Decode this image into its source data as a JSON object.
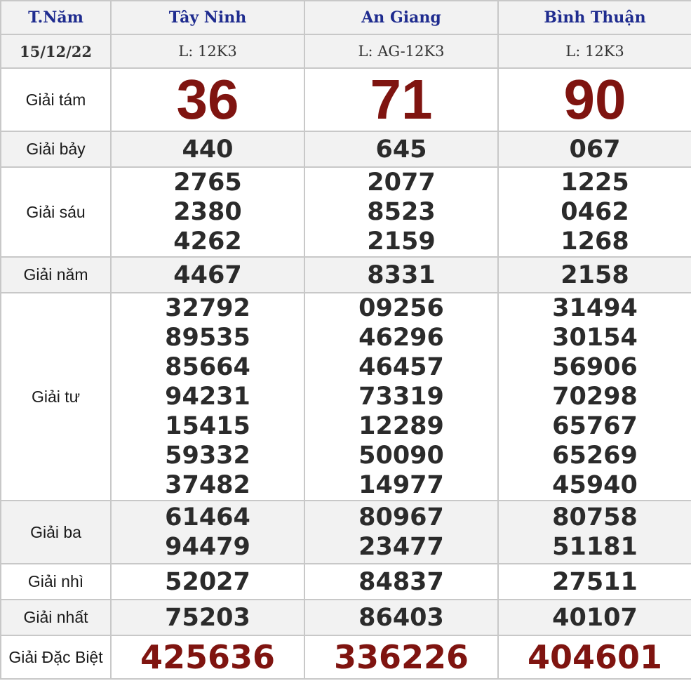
{
  "header": {
    "day_label": "T.Năm",
    "provinces": [
      "Tây Ninh",
      "An Giang",
      "Bình Thuận"
    ]
  },
  "subheader": {
    "date": "15/12/22",
    "tickets": [
      "L: 12K3",
      "L: AG-12K3",
      "L: 12K3"
    ]
  },
  "prizes": {
    "g8": {
      "label": "Giải tám",
      "values": [
        "36",
        "71",
        "90"
      ]
    },
    "g7": {
      "label": "Giải bảy",
      "values": [
        "440",
        "645",
        "067"
      ]
    },
    "g6": {
      "label": "Giải sáu",
      "values": [
        [
          "2765",
          "2380",
          "4262"
        ],
        [
          "2077",
          "8523",
          "2159"
        ],
        [
          "1225",
          "0462",
          "1268"
        ]
      ]
    },
    "g5": {
      "label": "Giải năm",
      "values": [
        "4467",
        "8331",
        "2158"
      ]
    },
    "g4": {
      "label": "Giải tư",
      "values": [
        [
          "32792",
          "89535",
          "85664",
          "94231",
          "15415",
          "59332",
          "37482"
        ],
        [
          "09256",
          "46296",
          "46457",
          "73319",
          "12289",
          "50090",
          "14977"
        ],
        [
          "31494",
          "30154",
          "56906",
          "70298",
          "65767",
          "65269",
          "45940"
        ]
      ]
    },
    "g3": {
      "label": "Giải ba",
      "values": [
        [
          "61464",
          "94479"
        ],
        [
          "80967",
          "23477"
        ],
        [
          "80758",
          "51181"
        ]
      ]
    },
    "g2": {
      "label": "Giải nhì",
      "values": [
        "52027",
        "84837",
        "27511"
      ]
    },
    "g1": {
      "label": "Giải nhất",
      "values": [
        "75203",
        "86403",
        "40107"
      ]
    },
    "gdb": {
      "label": "Giải Đặc Biệt",
      "values": [
        "425636",
        "336226",
        "404601"
      ]
    }
  },
  "colors": {
    "header_text": "#1f2c8f",
    "highlight_red": "#7f1410",
    "number_text": "#2b2b2b",
    "row_gray": "#f2f2f2",
    "border": "#c8c8c8"
  }
}
